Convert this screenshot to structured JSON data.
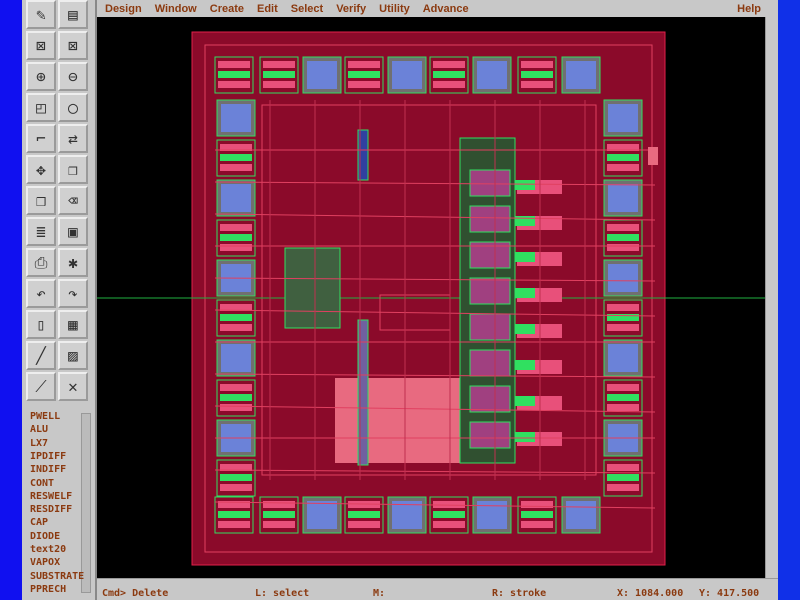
{
  "menu": [
    "Design",
    "Window",
    "Create",
    "Edit",
    "Select",
    "Verify",
    "Utility",
    "Advance"
  ],
  "help": "Help",
  "tools": [
    "draw-icon",
    "layer-palette-icon",
    "fit-icon",
    "zoom-fit-icon",
    "zoom-in-icon",
    "zoom-out-icon",
    "select-icon",
    "polygon-icon",
    "path-icon",
    "stretch-icon",
    "move-icon",
    "copy-icon",
    "paste-icon",
    "delete-icon",
    "stack-icon",
    "save-icon",
    "print-icon",
    "debug-icon",
    "undo-icon",
    "redo-icon",
    "door-icon",
    "ruler-icon",
    "pen-icon",
    "3d-icon",
    "measure-icon",
    "cross-icon"
  ],
  "layers": [
    "PWELL",
    "ALU",
    "LX7",
    "IPDIFF",
    "INDIFF",
    "CONT",
    "RESWELF",
    "RESDIFF",
    "CAP",
    "DIODE",
    "text20",
    "VAPOX",
    "SUBSTRATE",
    "PPRECH"
  ],
  "status": {
    "cmd": "Cmd> Delete",
    "l": "L: select",
    "m": "M:",
    "r": "R: stroke",
    "x": "X: 1084.000",
    "y": "Y: 417.500"
  },
  "colors": {
    "chip_fill": "#8b0a2a",
    "chip_border": "#e0204a",
    "pad_blue": "#6b82d8",
    "metal_green": "#30e060",
    "diff_pink": "#e8507a"
  }
}
